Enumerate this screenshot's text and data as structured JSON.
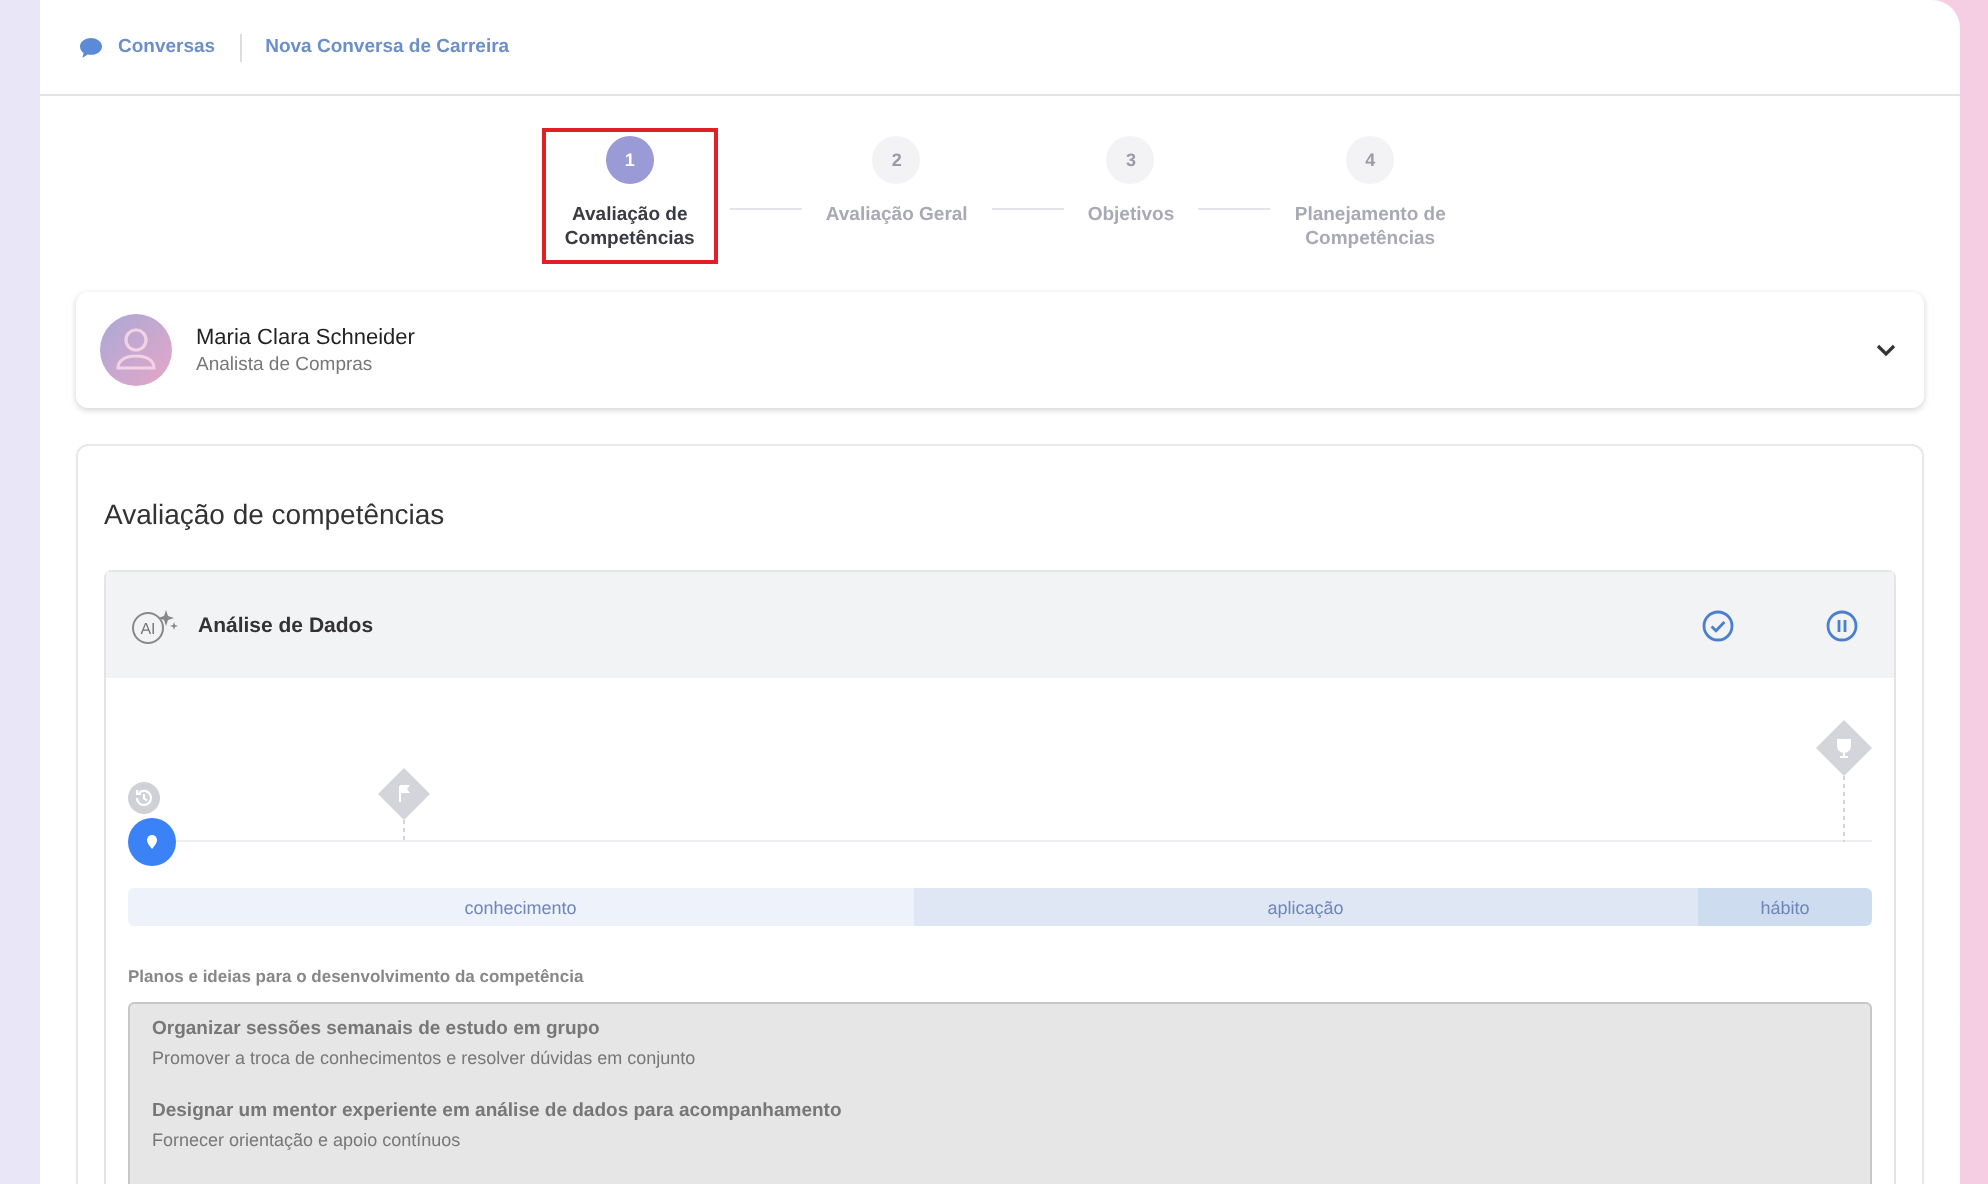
{
  "breadcrumb": [
    {
      "label": "Conversas"
    },
    {
      "label": "Nova Conversa de Carreira"
    }
  ],
  "stepper": [
    {
      "number": "1",
      "label": "Avaliação de Competências",
      "selected": true
    },
    {
      "number": "2",
      "label": "Avaliação Geral",
      "selected": false
    },
    {
      "number": "3",
      "label": "Objetivos",
      "selected": false
    },
    {
      "number": "4",
      "label": "Planejamento de Competências",
      "selected": false
    }
  ],
  "person": {
    "name": "Maria Clara Schneider",
    "role": "Analista de Compras",
    "expanded": false
  },
  "section": {
    "title": "Avaliação de competências",
    "competency": {
      "icon_text": "AI",
      "name": "Análise de Dados",
      "levels": [
        {
          "label": "conhecimento"
        },
        {
          "label": "aplicação"
        },
        {
          "label": "hábito"
        }
      ],
      "plans_label": "Planos e ideias para o desenvolvimento da competência",
      "plans": [
        {
          "title": "Organizar sessões semanais de estudo em grupo",
          "description": "Promover a troca de conhecimentos e resolver dúvidas em conjunto"
        },
        {
          "title": "Designar um mentor experiente em análise de dados para acompanhamento",
          "description": "Fornecer orientação e apoio contínuos"
        }
      ]
    }
  }
}
